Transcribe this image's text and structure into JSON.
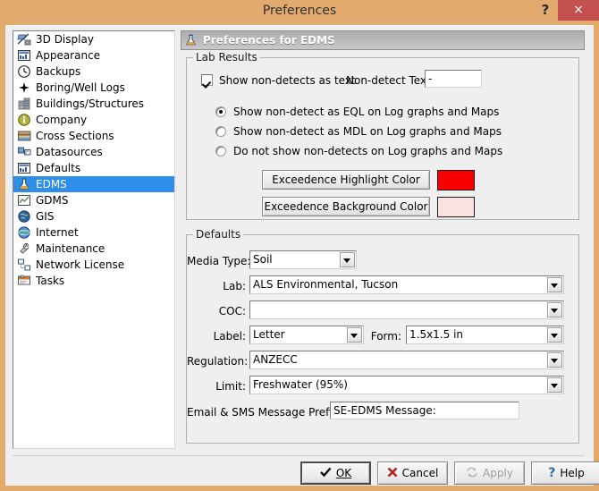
{
  "window": {
    "title": "Preferences",
    "help_icon": "?",
    "close_icon": "×"
  },
  "sidebar": {
    "items": [
      {
        "label": "3D Display",
        "icon": "3d-display-icon",
        "selected": false
      },
      {
        "label": "Appearance",
        "icon": "appearance-icon",
        "selected": false
      },
      {
        "label": "Backups",
        "icon": "backups-clock-icon",
        "selected": false
      },
      {
        "label": "Boring/Well Logs",
        "icon": "boring-well-logs-icon",
        "selected": false
      },
      {
        "label": "Buildings/Structures",
        "icon": "buildings-structures-icon",
        "selected": false
      },
      {
        "label": "Company",
        "icon": "company-info-icon",
        "selected": false
      },
      {
        "label": "Cross Sections",
        "icon": "cross-sections-icon",
        "selected": false
      },
      {
        "label": "Datasources",
        "icon": "datasources-icon",
        "selected": false
      },
      {
        "label": "Defaults",
        "icon": "defaults-icon",
        "selected": false
      },
      {
        "label": "EDMS",
        "icon": "edms-flask-icon",
        "selected": true
      },
      {
        "label": "GDMS",
        "icon": "gdms-chart-icon",
        "selected": false
      },
      {
        "label": "GIS",
        "icon": "gis-globe-icon",
        "selected": false
      },
      {
        "label": "Internet",
        "icon": "internet-globe-icon",
        "selected": false
      },
      {
        "label": "Maintenance",
        "icon": "maintenance-wrench-icon",
        "selected": false
      },
      {
        "label": "Network License",
        "icon": "network-license-icon",
        "selected": false
      },
      {
        "label": "Tasks",
        "icon": "tasks-icon",
        "selected": false
      }
    ]
  },
  "panel": {
    "header_title": "Preferences for EDMS",
    "header_icon": "edms-flask-icon"
  },
  "lab_results": {
    "group_title": "Lab Results",
    "show_non_detects_as_text": {
      "label": "Show non-detects as text",
      "checked": true
    },
    "non_detect_text": {
      "label": "Non-detect Text:",
      "value": "-"
    },
    "radio_group": [
      {
        "label": "Show non-detect as EQL on Log graphs and Maps",
        "selected": true
      },
      {
        "label": "Show non-detect as MDL on Log graphs and Maps",
        "selected": false
      },
      {
        "label": "Do not show non-detects on Log graphs and Maps",
        "selected": false
      }
    ],
    "highlight_color_button": "Exceedence Highlight Color",
    "highlight_color_value": "#f90000",
    "background_color_button": "Exceedence Background Color",
    "background_color_value": "#fbe2e2"
  },
  "defaults": {
    "group_title": "Defaults",
    "media_type": {
      "label": "Media Type:",
      "value": "Soil"
    },
    "lab": {
      "label": "Lab:",
      "value": "ALS Environmental, Tucson"
    },
    "coc": {
      "label": "COC:",
      "value": ""
    },
    "label_field": {
      "label": "Label:",
      "value": "Letter"
    },
    "form": {
      "label": "Form:",
      "value": "1.5x1.5 in"
    },
    "regulation": {
      "label": "Regulation:",
      "value": "ANZECC"
    },
    "limit": {
      "label": "Limit:",
      "value": "Freshwater (95%)"
    },
    "message_prefix": {
      "label": "Email & SMS Message Prefix:",
      "value": "SE-EDMS Message:"
    }
  },
  "footer": {
    "ok": "OK",
    "cancel": "Cancel",
    "apply": "Apply",
    "help": "Help"
  }
}
